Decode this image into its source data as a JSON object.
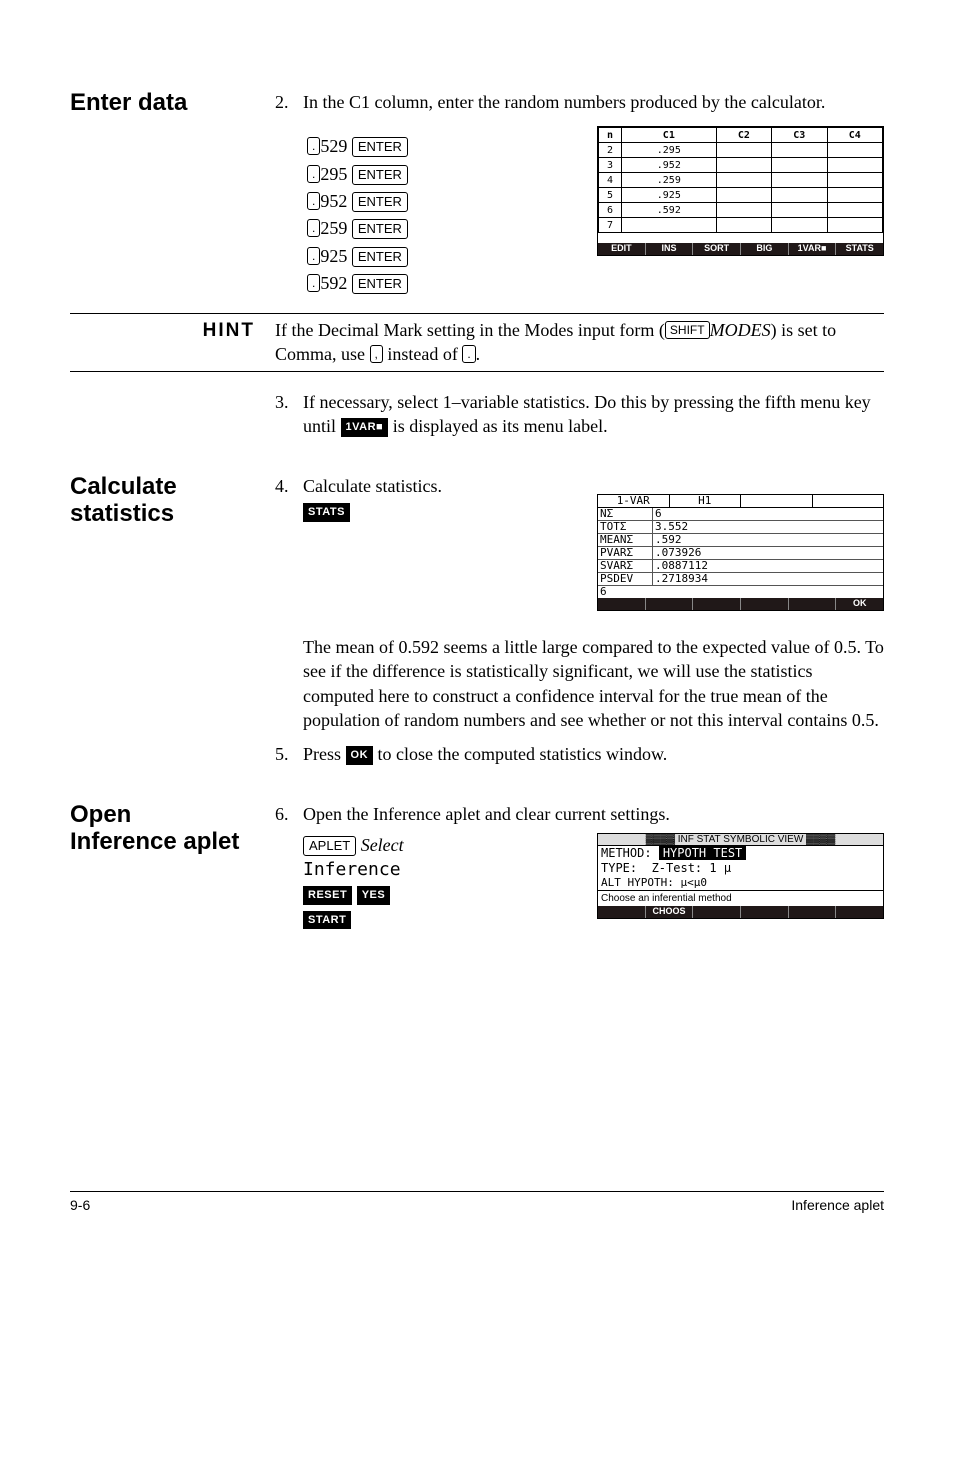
{
  "margin_labels": {
    "enter_data": "Enter data",
    "hint": "HINT",
    "calc_stats_1": "Calculate",
    "calc_stats_2": "statistics",
    "open_1": "Open",
    "open_2": "Inference aplet"
  },
  "step2": {
    "num": "2.",
    "text": "In the C1 column, enter the random numbers produced by the calculator.",
    "entries": [
      {
        "decimal": ".",
        "value": "529",
        "key": "ENTER"
      },
      {
        "decimal": ".",
        "value": "295",
        "key": "ENTER"
      },
      {
        "decimal": ".",
        "value": "952",
        "key": "ENTER"
      },
      {
        "decimal": ".",
        "value": "259",
        "key": "ENTER"
      },
      {
        "decimal": ".",
        "value": "925",
        "key": "ENTER"
      },
      {
        "decimal": ".",
        "value": "592",
        "key": "ENTER"
      }
    ],
    "calc_header": {
      "n": "n",
      "c1": "C1",
      "c2": "C2",
      "c3": "C3",
      "c4": "C4"
    },
    "calc_rows": [
      {
        "n": "2",
        "c1": ".295"
      },
      {
        "n": "3",
        "c1": ".952"
      },
      {
        "n": "4",
        "c1": ".259"
      },
      {
        "n": "5",
        "c1": ".925"
      },
      {
        "n": "6",
        "c1": ".592"
      },
      {
        "n": "7",
        "c1": ""
      }
    ],
    "softkeys": [
      "EDIT",
      "INS",
      "SORT",
      "BIG",
      "1VAR■",
      "STATS"
    ]
  },
  "hint": {
    "text_a": "If the Decimal Mark setting in the Modes input form (",
    "shift": "SHIFT",
    "modes": "MODES",
    "text_b": ") is set to Comma, use ",
    "comma": ",",
    "text_c": " instead of ",
    "period": ".",
    "text_d": "."
  },
  "step3": {
    "num": "3.",
    "text_a": "If necessary, select 1–variable statistics. Do this by pressing the fifth menu key until ",
    "soft": "1VAR■",
    "text_b": " is displayed as its menu label."
  },
  "step4": {
    "num": "4.",
    "text_a": "Calculate statistics.",
    "soft": "STATS",
    "calc": {
      "header": {
        "col1": "1-VAR",
        "col2": "H1"
      },
      "rows": [
        {
          "label": "NΣ",
          "value": "6"
        },
        {
          "label": "TOTΣ",
          "value": "3.552"
        },
        {
          "label": "MEANΣ",
          "value": ".592"
        },
        {
          "label": "PVARΣ",
          "value": ".073926"
        },
        {
          "label": "SVARΣ",
          "value": ".0887112"
        },
        {
          "label": "PSDEV",
          "value": ".2718934"
        }
      ],
      "nval": "6",
      "softkeys": [
        "",
        "",
        "",
        "",
        "",
        "OK"
      ]
    },
    "para": "The mean of 0.592 seems a little large compared to the expected value of 0.5. To see if the difference is statistically significant, we will use the statistics computed here to construct a confidence interval for the true mean of the population of random numbers and see whether or not this interval contains 0.5."
  },
  "step5": {
    "num": "5.",
    "text_a": "Press ",
    "soft": "OK",
    "text_b": " to close the computed statistics window."
  },
  "step6": {
    "num": "6.",
    "text": "Open the Inference aplet and clear current settings.",
    "keys": {
      "aplet": "APLET",
      "select": "Select",
      "inference": "Inference",
      "reset": "RESET",
      "yes": "YES",
      "start": "START"
    },
    "calc": {
      "title": "INF STAT SYMBOLIC VIEW",
      "method_label": "METHOD:",
      "method_value": "HYPOTH TEST",
      "type_label": "TYPE:",
      "type_value": "Z-Test: 1 μ",
      "alt_label": "ALT HYPOTH:",
      "alt_value": "μ<μ0",
      "help": "Choose an inferential method",
      "softkeys": [
        "",
        "CHOOS",
        "",
        "",
        "",
        ""
      ]
    }
  },
  "footer": {
    "page": "9-6",
    "title": "Inference aplet"
  }
}
